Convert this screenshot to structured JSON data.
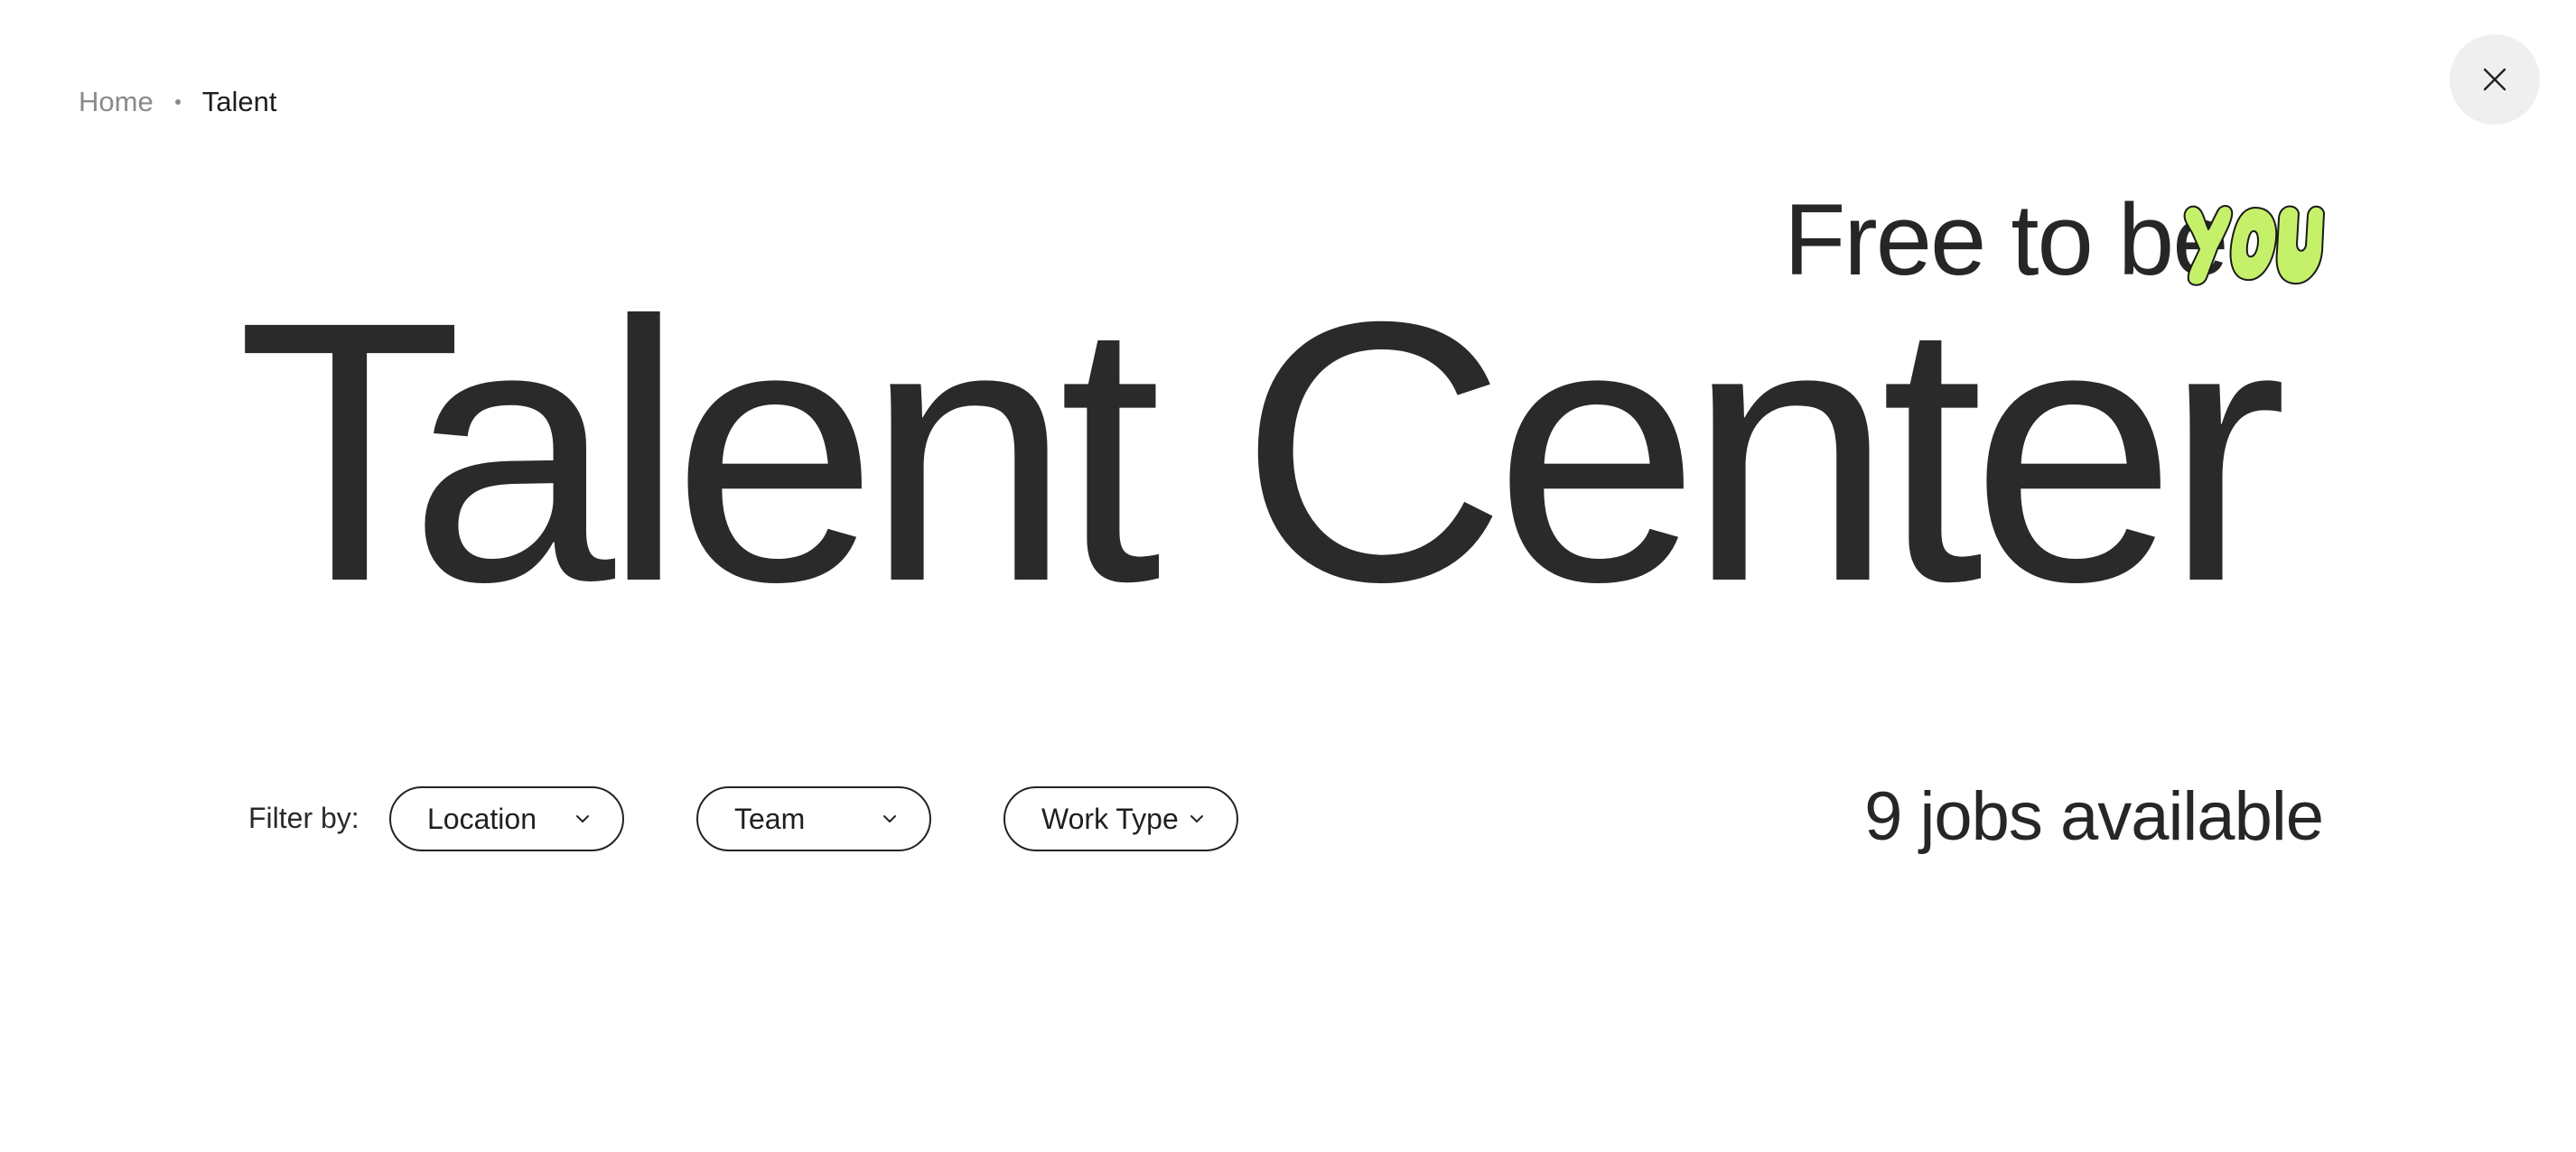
{
  "breadcrumb": {
    "home": "Home",
    "current": "Talent"
  },
  "close": {
    "icon": "close-icon",
    "label": "Close"
  },
  "hero": {
    "tagline": "Free to be",
    "tagline_art_word": "you",
    "title": "Talent Center",
    "accent_color": "#c5f06a"
  },
  "filters": {
    "label": "Filter by:",
    "items": [
      {
        "label": "Location",
        "icon": "chevron-down-icon"
      },
      {
        "label": "Team",
        "icon": "chevron-down-icon"
      },
      {
        "label": "Work Type",
        "icon": "chevron-down-icon"
      }
    ]
  },
  "jobs": {
    "count_text": "9 jobs available"
  }
}
